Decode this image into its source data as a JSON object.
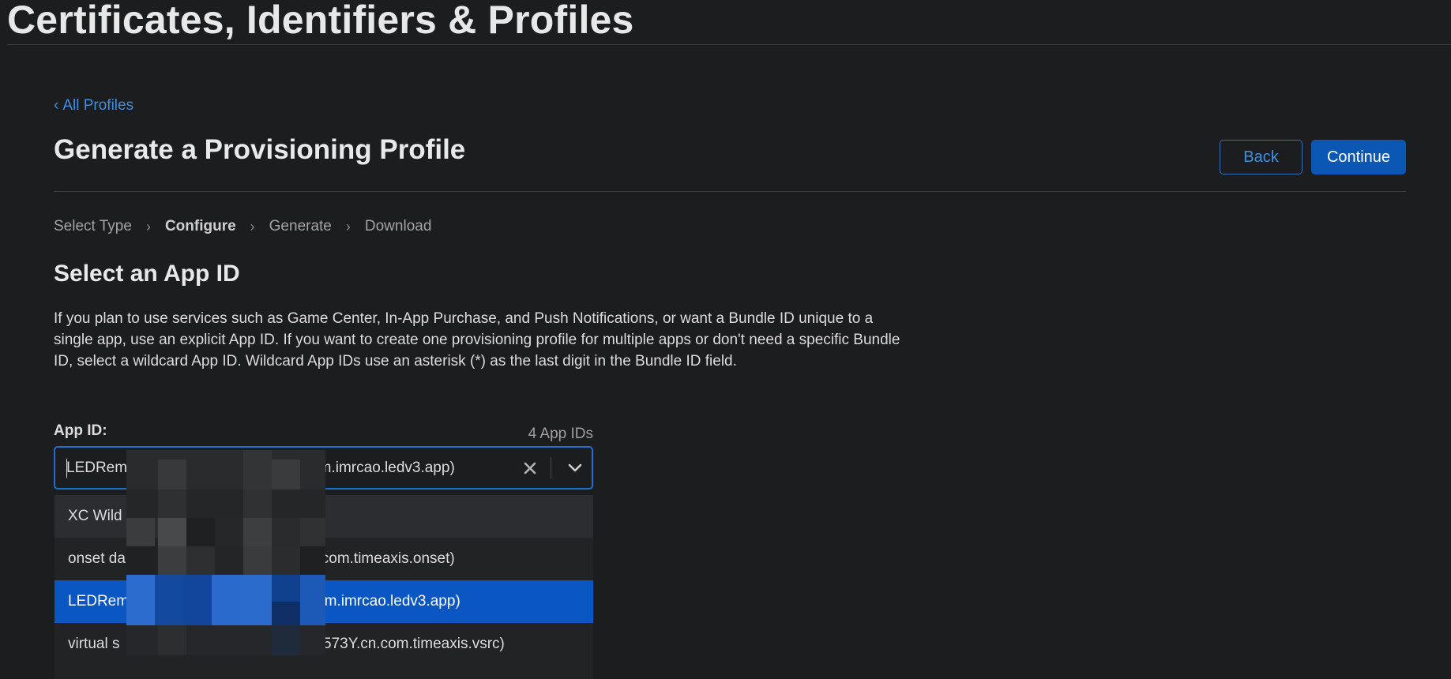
{
  "page": {
    "top_title": "Certificates, Identifiers & Profiles",
    "breadcrumb": {
      "chevron": "‹",
      "label": "All Profiles"
    },
    "heading": "Generate a Provisioning Profile",
    "buttons": {
      "back": "Back",
      "continue": "Continue"
    }
  },
  "steps": [
    "Select Type",
    "Configure",
    "Generate",
    "Download"
  ],
  "active_step": "Configure",
  "section": {
    "title": "Select an App ID",
    "description": "If you plan to use services such as Game Center, In-App Purchase, and Push Notifications, or want a Bundle ID unique to a single app, use an explicit App ID. If you want to create one provisioning profile for multiple apps or don't need a specific Bundle ID, select a wildcard App ID. Wildcard App IDs use an asterisk (*) as the last digit in the Bundle ID field."
  },
  "app_id_field": {
    "label": "App ID:",
    "count": "4 App IDs",
    "selected_prefix": "LEDRem",
    "selected_suffix": "Y.com.imrcao.ledv3.app)",
    "options": [
      {
        "prefix": "XC Wild",
        "suffix": ""
      },
      {
        "prefix": "onset da",
        "suffix": "n.com.timeaxis.onset)"
      },
      {
        "prefix": "LEDRem",
        "suffix": "Y.com.imrcao.ledv3.app)"
      },
      {
        "prefix": "virtual s",
        "suffix": "2573Y.cn.com.timeaxis.vsrc)"
      }
    ],
    "hover_index": 0,
    "selected_index": 2
  },
  "icons": {
    "clear": "close-icon",
    "dropdown": "chevron-down-icon",
    "breadcrumb": "chevron-left-icon",
    "step_separator": "chevron-right-icon"
  },
  "colors": {
    "background": "#1c1d1f",
    "accent": "#0a58b4",
    "link": "#3d8fe0",
    "focus_border": "#1e6fd0",
    "selected_option": "#0a56c2"
  }
}
